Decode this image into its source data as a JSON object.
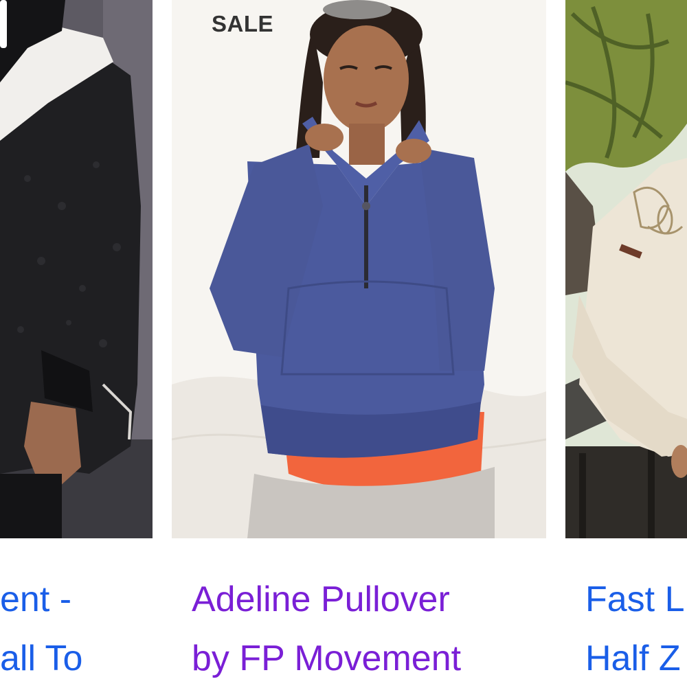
{
  "products": [
    {
      "title_line1": "ent -",
      "title_line2": "all To",
      "link_color": "#1a5ee8"
    },
    {
      "badge": "SALE",
      "title_line1": "Adeline Pullover",
      "title_line2": "by FP Movement",
      "link_color": "#7a1fd6"
    },
    {
      "title_line1": "Fast L",
      "title_line2": "Half Z",
      "link_color": "#1a5ee8"
    }
  ]
}
